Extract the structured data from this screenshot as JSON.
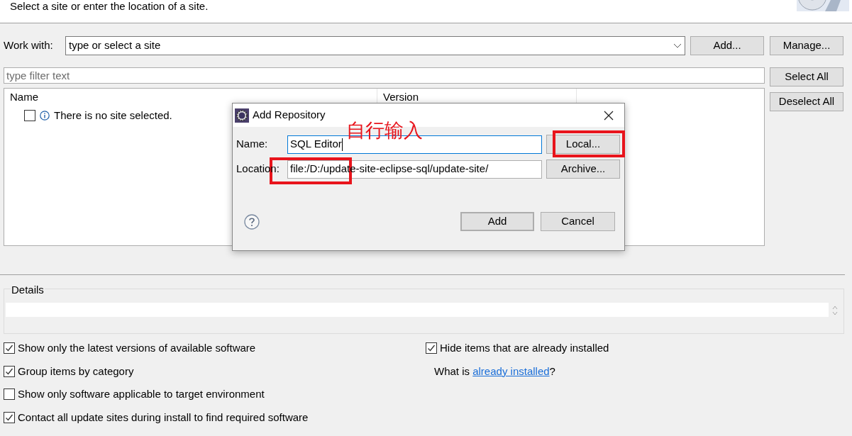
{
  "header": {
    "instruction": "Select a site or enter the location of a site."
  },
  "work_with": {
    "label": "Work with:",
    "value": "type or select a site"
  },
  "top_buttons": [
    "Add...",
    "Manage..."
  ],
  "filter": {
    "placeholder": "type filter text"
  },
  "side_buttons": [
    "Select All",
    "Deselect All"
  ],
  "table": {
    "columns": [
      "Name",
      "Version"
    ],
    "rows": [
      {
        "checked": false,
        "text": "There is no site selected."
      }
    ]
  },
  "details": {
    "title": "Details"
  },
  "options_left": [
    {
      "label": "Show only the latest versions of available software",
      "checked": true
    },
    {
      "label": "Group items by category",
      "checked": true
    },
    {
      "label": "Show only software applicable to target environment",
      "checked": false
    },
    {
      "label": "Contact all update sites during install to find required software",
      "checked": true
    }
  ],
  "options_right": [
    {
      "label": "Hide items that are already installed",
      "checked": true
    }
  ],
  "installed_note": {
    "text": "What is ",
    "link": "already installed",
    "suffix": "?"
  },
  "dialog": {
    "title": "Add Repository",
    "name_label": "Name:",
    "name_value": "SQL Editor",
    "location_label": "Location:",
    "location_value": "file:/D:/update-site-eclipse-sql/update-site/",
    "side_buttons": [
      "Local...",
      "Archive..."
    ],
    "buttons": [
      "Add",
      "Cancel"
    ]
  },
  "annotation": {
    "text": "自行输入"
  }
}
